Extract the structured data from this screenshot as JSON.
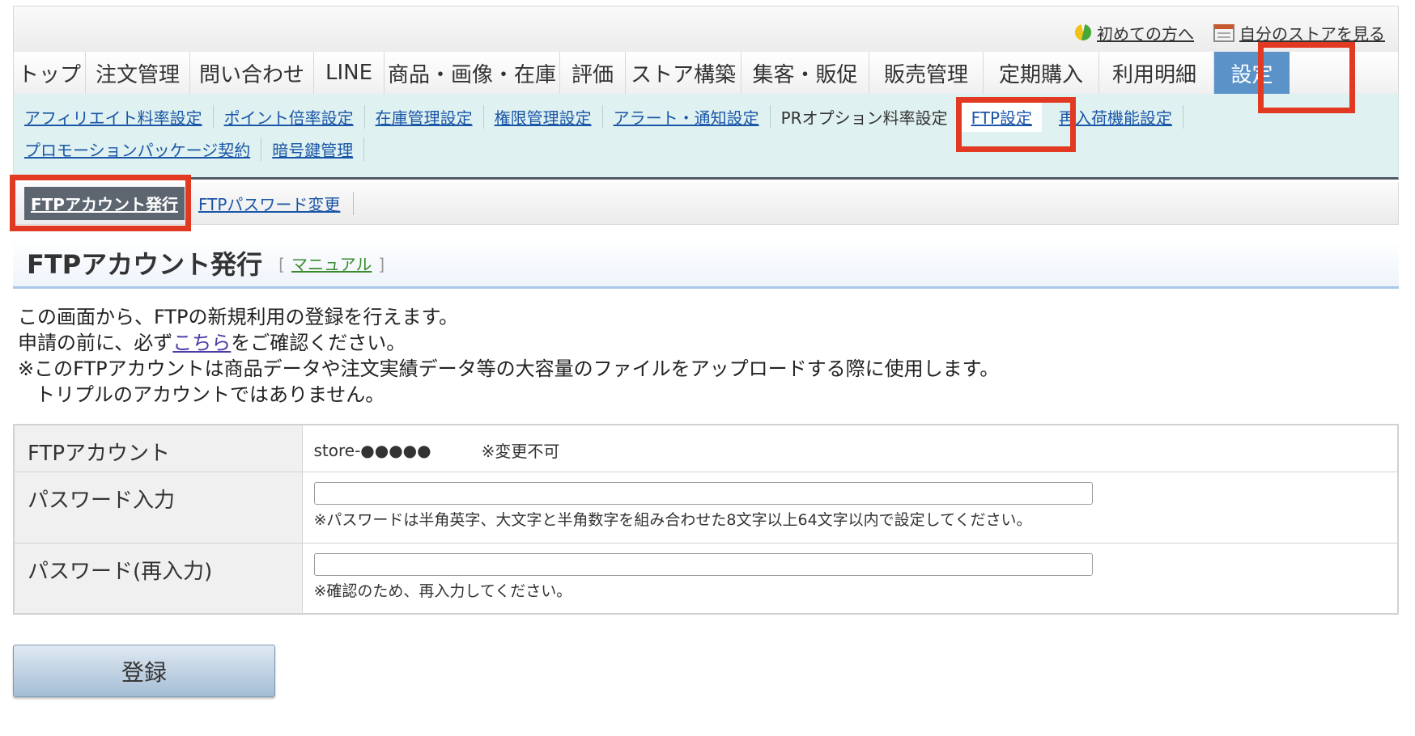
{
  "header": {
    "links": [
      {
        "label": "初めての方へ",
        "icon": "beginner-leaf-icon"
      },
      {
        "label": "自分のストアを見る",
        "icon": "storefront-icon"
      }
    ]
  },
  "main_nav": {
    "tabs": [
      {
        "label": "トップ"
      },
      {
        "label": "注文管理"
      },
      {
        "label": "問い合わせ"
      },
      {
        "label": "LINE"
      },
      {
        "label": "商品・画像・在庫"
      },
      {
        "label": "評価"
      },
      {
        "label": "ストア構築"
      },
      {
        "label": "集客・販促"
      },
      {
        "label": "販売管理"
      },
      {
        "label": "定期購入"
      },
      {
        "label": "利用明細"
      },
      {
        "label": "設定"
      }
    ],
    "active": "設定"
  },
  "sub_nav": {
    "row1": [
      {
        "label": "アフィリエイト料率設定"
      },
      {
        "label": "ポイント倍率設定"
      },
      {
        "label": "在庫管理設定"
      },
      {
        "label": "権限管理設定"
      },
      {
        "label": "アラート・通知設定"
      },
      {
        "label": "PRオプション料率設定"
      },
      {
        "label": "FTP設定"
      },
      {
        "label": "再入荷機能設定"
      }
    ],
    "row2": [
      {
        "label": "プロモーションパッケージ契約"
      },
      {
        "label": "暗号鍵管理"
      }
    ],
    "active": "FTP設定"
  },
  "tertiary_nav": {
    "active_label": "FTPアカウント発行",
    "other_label": "FTPパスワード変更"
  },
  "page": {
    "title": "FTPアカウント発行",
    "manual_label": "マニュアル",
    "bracket_open": "[",
    "bracket_close": "]"
  },
  "intro": {
    "line1": "この画面から、FTPの新規利用の登録を行えます。",
    "line2_before": "申請の前に、必ず",
    "line2_link": "こちら",
    "line2_after": "をご確認ください。",
    "line3": "※このFTPアカウントは商品データや注文実績データ等の大容量のファイルをアップロードする際に使用します。",
    "line4": "トリプルのアカウントではありません。"
  },
  "form": {
    "account_label": "FTPアカウント",
    "account_value": "store-●●●●●",
    "account_note": "※変更不可",
    "password_label": "パスワード入力",
    "password_value": "",
    "password_note": "※パスワードは半角英字、大文字と半角数字を組み合わせた8文字以上64文字以内で設定してください。",
    "password_confirm_label": "パスワード(再入力)",
    "password_confirm_value": "",
    "password_confirm_note": "※確認のため、再入力してください。"
  },
  "submit_label": "登録",
  "colors": {
    "active_tab": "#5b93c9",
    "subnav_bg": "#dff1f0",
    "link": "#1a56a8",
    "highlight": "#e23a22",
    "button_top": "#dfe9f3",
    "button_bottom": "#a4bdd4"
  }
}
